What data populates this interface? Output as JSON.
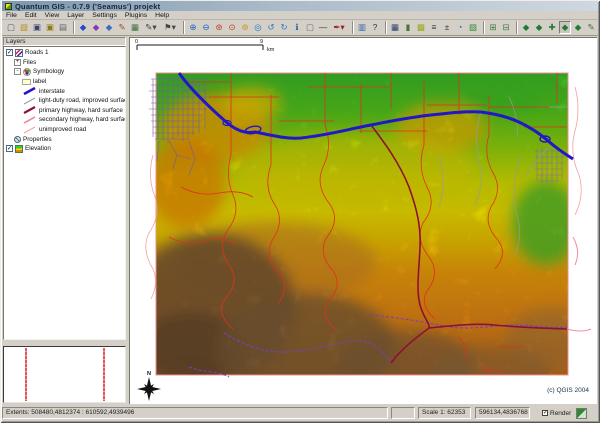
{
  "window": {
    "title": "Quantum GIS - 0.7.9 ('Seamus')  projekt"
  },
  "menu": {
    "items": [
      "File",
      "Edit",
      "View",
      "Layer",
      "Settings",
      "Plugins",
      "Help"
    ]
  },
  "toolbar": {
    "items": [
      {
        "n": "new-project",
        "g": "▢",
        "c": "#4a5a6a"
      },
      {
        "n": "open-project",
        "g": "▨",
        "c": "#b38f1d"
      },
      {
        "n": "save-project",
        "g": "▣",
        "c": "#39406e"
      },
      {
        "n": "save-project-as",
        "g": "▣",
        "c": "#8a7a10"
      },
      {
        "n": "print",
        "g": "▤",
        "c": "#5a5f66"
      },
      {
        "sep": true
      },
      {
        "n": "add-vector-layer",
        "g": "◆",
        "c": "#2747c9"
      },
      {
        "n": "add-raster-layer",
        "g": "◆",
        "c": "#8a35b5"
      },
      {
        "n": "add-postgis-layer",
        "g": "◆",
        "c": "#3a6fc0"
      },
      {
        "n": "new-vector-layer",
        "g": "✎",
        "c": "#9c4a1b"
      },
      {
        "n": "toggle-editing",
        "g": "▦",
        "c": "#3b6e3b"
      },
      {
        "n": "capture-point",
        "g": "✎▾",
        "c": "#444444",
        "wide": true
      },
      {
        "n": "capture-line",
        "g": "⚑▾",
        "c": "#444444",
        "wide": true
      },
      {
        "sep": true
      },
      {
        "n": "zoom-in",
        "g": "⊕",
        "c": "#1a62c5"
      },
      {
        "n": "zoom-out",
        "g": "⊖",
        "c": "#1a62c5"
      },
      {
        "n": "zoom-full-extent",
        "g": "⊛",
        "c": "#c23b22"
      },
      {
        "n": "zoom-to-selection",
        "g": "⊙",
        "c": "#c23b22"
      },
      {
        "n": "zoom-to-layer",
        "g": "⊚",
        "c": "#d08a1a"
      },
      {
        "n": "pan-map",
        "g": "◎",
        "c": "#2a74c9"
      },
      {
        "n": "zoom-last",
        "g": "↺",
        "c": "#2a74c9"
      },
      {
        "n": "zoom-next",
        "g": "↻",
        "c": "#2a74c9"
      },
      {
        "n": "identify-features",
        "g": "ℹ",
        "c": "#1d5fa8"
      },
      {
        "n": "select-features",
        "g": "▢",
        "c": "#6a6a6a"
      },
      {
        "n": "measure-line",
        "g": "—",
        "c": "#333333"
      },
      {
        "n": "map-annotation",
        "g": "✒▾",
        "c": "#a02020",
        "wide": true
      },
      {
        "sep": true
      },
      {
        "n": "print-composer",
        "g": "▥",
        "c": "#2a62a8"
      },
      {
        "n": "help-contents",
        "g": "?",
        "c": "#2a3a4a"
      },
      {
        "sep": true
      },
      {
        "n": "attribute-table",
        "g": "▦",
        "c": "#223d66"
      },
      {
        "n": "plugin-manager",
        "g": "▮",
        "c": "#49743d"
      },
      {
        "n": "georeferencer",
        "g": "▩",
        "c": "#9aa818"
      },
      {
        "n": "gps-tools",
        "g": "≡",
        "c": "#3a3a3a"
      },
      {
        "n": "coordinate-capture",
        "g": "±",
        "c": "#3a3a3a"
      },
      {
        "n": "compass-tool",
        "g": "◔",
        "c": "#1f6fd0"
      },
      {
        "n": "export-image",
        "g": "▧",
        "c": "#2f8a2f"
      },
      {
        "sep": true
      },
      {
        "n": "zoom-raster-in",
        "g": "⊞",
        "c": "#3c7a3c"
      },
      {
        "n": "zoom-raster-out",
        "g": "⊟",
        "c": "#3c7a3c"
      },
      {
        "sep": true
      },
      {
        "n": "wfs-plugin",
        "g": "◆",
        "c": "#1f7a33"
      },
      {
        "n": "wms-plugin",
        "g": "◆",
        "c": "#1f7a33"
      },
      {
        "n": "north-arrow-plugin",
        "g": "✚",
        "c": "#1f7a33"
      },
      {
        "n": "scalebar-plugin",
        "g": "◆",
        "c": "#1f7a33",
        "pressed": true
      },
      {
        "n": "copyright-plugin",
        "g": "◆",
        "c": "#1f7a33"
      },
      {
        "n": "grass-tools",
        "g": "✎",
        "c": "#3f6f2f"
      }
    ]
  },
  "legend": {
    "title": "Layers",
    "items": [
      {
        "label": "Roads 1",
        "type": "layer",
        "icon": "roads",
        "indent": 0,
        "checked": true
      },
      {
        "label": "Files",
        "type": "branch",
        "toggle": "+",
        "indent": 1
      },
      {
        "label": "Symbology",
        "type": "branch",
        "toggle": "-",
        "icon": "palette",
        "indent": 1
      },
      {
        "label": "label",
        "type": "item",
        "icon": "label",
        "indent": 2
      },
      {
        "label": "interstate",
        "type": "symbol",
        "color": "#2216c8",
        "w": 2.6,
        "indent": 2
      },
      {
        "label": "light-duty road, improved surface",
        "type": "symbol",
        "color": "#9a9a9a",
        "w": 1,
        "indent": 2
      },
      {
        "label": "primary highway, hard surface",
        "type": "symbol",
        "color": "#8e1034",
        "w": 2.2,
        "indent": 2
      },
      {
        "label": "secondary highway, hard surface",
        "type": "symbol",
        "color": "#ee8f9e",
        "w": 1.8,
        "indent": 2
      },
      {
        "label": "unimproved road",
        "type": "symbol",
        "color": "#f0a0a0",
        "w": 1,
        "indent": 2
      },
      {
        "label": "Properties",
        "type": "item",
        "icon": "wrench",
        "indent": 1
      },
      {
        "label": "Elevation",
        "type": "layer",
        "icon": "elevation",
        "indent": 0,
        "checked": true
      }
    ]
  },
  "map": {
    "scalebar": {
      "left_label": "0",
      "right_label": "9",
      "unit": "km"
    },
    "north_label": "N",
    "copyright": "(c) QGIS 2004"
  },
  "colors": {
    "interstate": "#2216c8",
    "primary": "#8e1034",
    "secondary": "#ee8f9e",
    "unimproved": "#f0a0a0",
    "light_duty": "#9a9a9a",
    "red_road": "#e03020",
    "purple_road": "#7a3fc0",
    "city": "#6f5fa8",
    "raster_border": "#f08c8c"
  },
  "statusbar": {
    "extents": "Extents: 508480,4812374 : 610592,4939496",
    "scale": "Scale 1: 62353",
    "coords": "596134,4836768",
    "render_label": "Render"
  }
}
